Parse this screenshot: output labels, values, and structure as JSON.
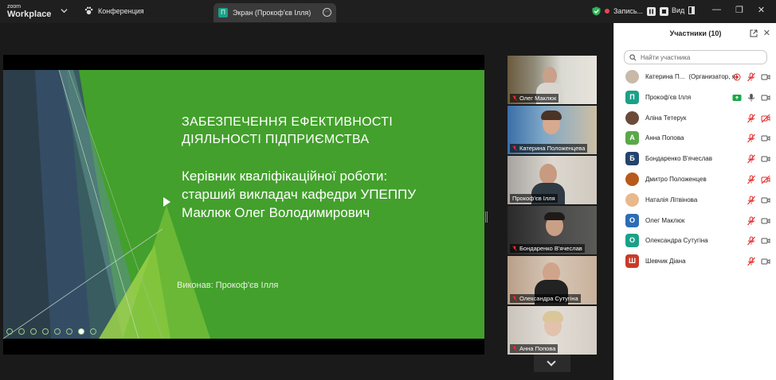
{
  "app": {
    "brand_small": "zoom",
    "brand_big": "Workplace"
  },
  "tabs": {
    "meeting_label": "Конференция",
    "screen_label": "Экран (Прокоф'єв Ілля)",
    "screen_badge": "П"
  },
  "header": {
    "recording_label": "Запись...",
    "view_label": "Вид"
  },
  "window_controls": {
    "minimize": "—",
    "restore": "❐",
    "close": "✕"
  },
  "slide": {
    "title_line1": "ЗАБЕЗПЕЧЕННЯ ЕФЕКТИВНОСТІ",
    "title_line2": "ДІЯЛЬНОСТІ ПІДПРИЄМСТВА",
    "sub_line1": "Керівник кваліфікаційної роботи:",
    "sub_line2": "старший викладач кафедри УПЕППУ",
    "sub_line3": "Маклюк Олег Володимирович",
    "author": "Виконав: Прокоф'єв Ілля"
  },
  "video_tiles": [
    {
      "name": "Олег Маклюк",
      "muted": true
    },
    {
      "name": "Катерина Положенцева",
      "muted": true
    },
    {
      "name": "Прокоф'єв Ілля",
      "muted": false,
      "active": true
    },
    {
      "name": "Бондаренко В'ячеслав",
      "muted": true
    },
    {
      "name": "Олександра Сутугіна",
      "muted": true
    },
    {
      "name": "Анна Попова",
      "muted": true
    }
  ],
  "participants_panel": {
    "title": "Участники (10)",
    "search_placeholder": "Найти участника",
    "items": [
      {
        "name": "Катерина П...",
        "role": "(Организатор, я)",
        "avatar_letter": "",
        "avatar_color": "#c9b9a8",
        "mic": "muted",
        "video": "on",
        "recording": true
      },
      {
        "name": "Прокоф'єв Ілля",
        "role": "",
        "avatar_letter": "П",
        "avatar_color": "#1aa187",
        "mic": "on",
        "video": "on",
        "sharing": true
      },
      {
        "name": "Аліна Тетерук",
        "role": "",
        "avatar_letter": "",
        "avatar_color": "#6b4a3a",
        "mic": "muted",
        "video": "off"
      },
      {
        "name": "Анна Попова",
        "role": "",
        "avatar_letter": "А",
        "avatar_color": "#5aa84a",
        "mic": "muted",
        "video": "on"
      },
      {
        "name": "Бондаренко В'ячеслав",
        "role": "",
        "avatar_letter": "Б",
        "avatar_color": "#24446e",
        "mic": "muted",
        "video": "on"
      },
      {
        "name": "Дмитро Положенцев",
        "role": "",
        "avatar_letter": "",
        "avatar_color": "#b85a1a",
        "mic": "muted",
        "video": "off"
      },
      {
        "name": "Наталія Літвінова",
        "role": "",
        "avatar_letter": "",
        "avatar_color": "#e8b98a",
        "mic": "muted",
        "video": "on"
      },
      {
        "name": "Олег Маклюк",
        "role": "",
        "avatar_letter": "О",
        "avatar_color": "#2d6db5",
        "mic": "muted",
        "video": "on"
      },
      {
        "name": "Олександра Сутугіна",
        "role": "",
        "avatar_letter": "О",
        "avatar_color": "#1aa187",
        "mic": "muted",
        "video": "on"
      },
      {
        "name": "Шевчик Діана",
        "role": "",
        "avatar_letter": "Ш",
        "avatar_color": "#c93a2a",
        "mic": "muted",
        "video": "on"
      }
    ]
  },
  "colors": {
    "accent": "#0e72ed",
    "muted_red": "#e02f2f",
    "slide_green": "#43a02c",
    "active_tile": "#2fd27a"
  }
}
